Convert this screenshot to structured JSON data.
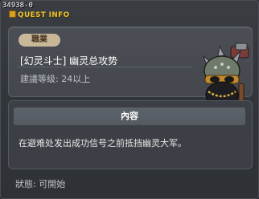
{
  "quest": {
    "id_label": "34938-0",
    "window_title": "QUEST INFO",
    "job_badge": "職業",
    "title": "[幻灵斗士] 幽灵总攻势",
    "level": "建議等级: 24以上",
    "content_header": "內容",
    "content_text": "在避难处发出成功信号之前抵挡幽灵大军。",
    "status": "狀態:  可開始"
  },
  "colors": {
    "title_accent": "#e8c23a",
    "badge": "#c9b79a"
  },
  "icons": {
    "header": "quest-scroll-icon",
    "npc": "goblin-warrior-portrait"
  }
}
